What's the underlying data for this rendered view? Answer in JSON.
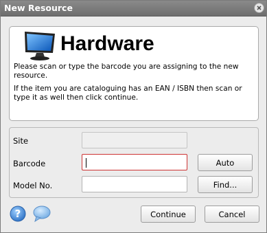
{
  "window": {
    "title": "New Resource"
  },
  "header": {
    "heading": "Hardware",
    "line1": "Please scan or type the barcode you are assigning to the new resource.",
    "line2": "If the item you are cataloguing has an EAN / ISBN then scan or type it as well then click continue."
  },
  "form": {
    "site_label": "Site",
    "site_value": "",
    "barcode_label": "Barcode",
    "barcode_value": "",
    "model_label": "Model No.",
    "model_value": "",
    "auto_label": "Auto",
    "find_label": "Find..."
  },
  "footer": {
    "continue_label": "Continue",
    "cancel_label": "Cancel"
  },
  "colors": {
    "titlebar": "#7a7a7a",
    "focus_border": "#cc3333",
    "help_icon": "#3b7fd0"
  }
}
